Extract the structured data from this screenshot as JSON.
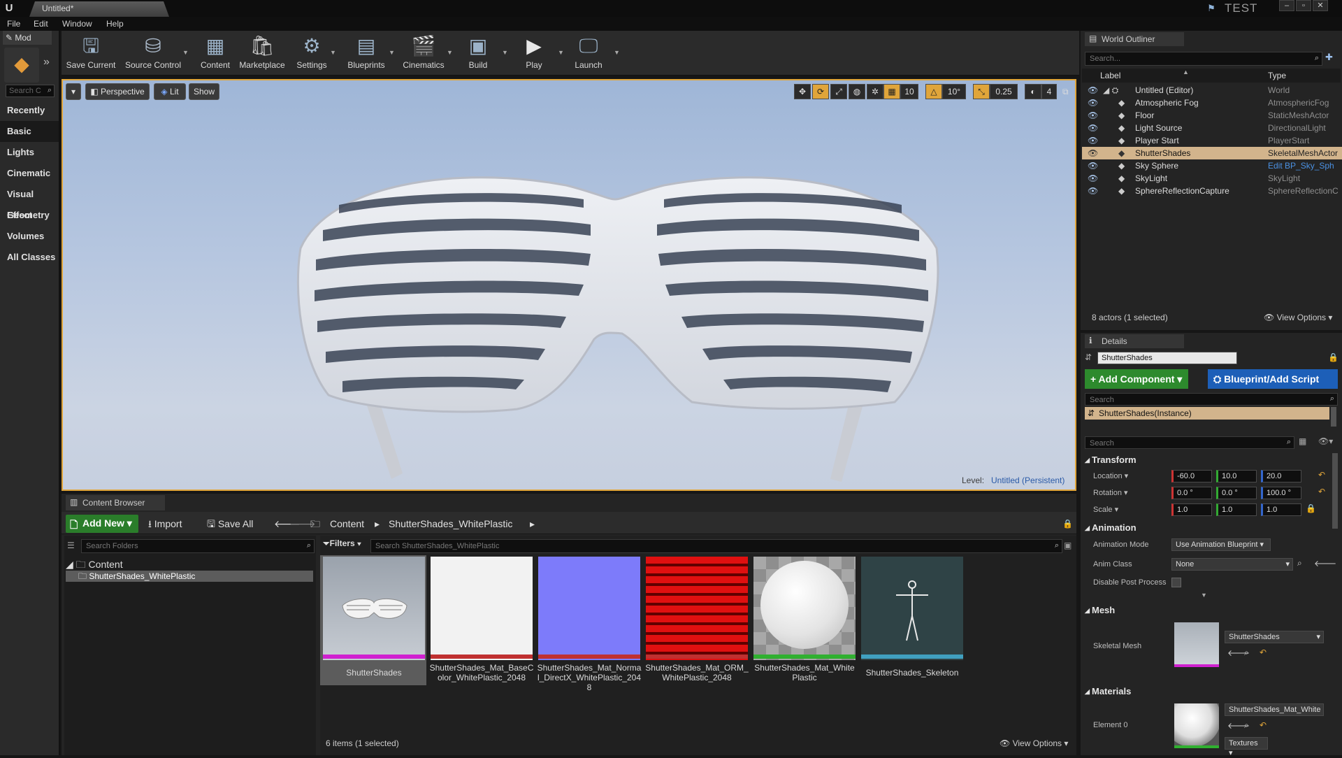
{
  "titlebar": {
    "doc_tab": "Untitled*",
    "project": "TEST"
  },
  "menu": [
    "File",
    "Edit",
    "Window",
    "Help"
  ],
  "modes": {
    "tab_label": "Mod",
    "search_placeholder": "Search C",
    "categories": [
      "Recently Pla",
      "Basic",
      "Lights",
      "Cinematic",
      "Visual Effect",
      "Geometry",
      "Volumes",
      "All Classes"
    ]
  },
  "toolbar": {
    "save": "Save Current",
    "source": "Source Control",
    "content": "Content",
    "marketplace": "Marketplace",
    "settings": "Settings",
    "blueprints": "Blueprints",
    "cinematics": "Cinematics",
    "build": "Build",
    "play": "Play",
    "launch": "Launch"
  },
  "viewport": {
    "perspective": "Perspective",
    "lit": "Lit",
    "show": "Show",
    "grid_snap": "10",
    "rot_snap": "10°",
    "scale_snap": "0.25",
    "cam_speed": "4",
    "level_label": "Level:",
    "level_value": "Untitled (Persistent)"
  },
  "content_browser": {
    "tab": "Content Browser",
    "add_new": "Add New",
    "import": "Import",
    "save_all": "Save All",
    "path": [
      "Content",
      "ShutterShades_WhitePlastic"
    ],
    "search_folders": "Search Folders",
    "tree_root": "Content",
    "tree_child": "ShutterShades_WhitePlastic",
    "filters": "Filters",
    "search_assets": "Search ShutterShades_WhitePlastic",
    "status": "6 items (1 selected)",
    "view_options": "View Options",
    "assets": [
      {
        "name": "ShutterShades",
        "color": "#d020d0"
      },
      {
        "name": "ShutterShades_Mat_BaseColor_WhitePlastic_2048",
        "color": "#c03030"
      },
      {
        "name": "ShutterShades_Mat_Normal_DirectX_WhitePlastic_2048",
        "color": "#c03030"
      },
      {
        "name": "ShutterShades_Mat_ORM_WhitePlastic_2048",
        "color": "#c03030"
      },
      {
        "name": "ShutterShades_Mat_WhitePlastic",
        "color": "#30b030"
      },
      {
        "name": "ShutterShades_Skeleton",
        "color": "#40a0c0"
      }
    ]
  },
  "world_outliner": {
    "tab": "World Outliner",
    "search_placeholder": "Search...",
    "col_label": "Label",
    "col_type": "Type",
    "rows": [
      {
        "label": "Untitled (Editor)",
        "type": "World"
      },
      {
        "label": "Atmospheric Fog",
        "type": "AtmosphericFog"
      },
      {
        "label": "Floor",
        "type": "StaticMeshActor"
      },
      {
        "label": "Light Source",
        "type": "DirectionalLight"
      },
      {
        "label": "Player Start",
        "type": "PlayerStart"
      },
      {
        "label": "ShutterShades",
        "type": "SkeletalMeshActor"
      },
      {
        "label": "Sky Sphere",
        "type": "Edit BP_Sky_Sph"
      },
      {
        "label": "SkyLight",
        "type": "SkyLight"
      },
      {
        "label": "SphereReflectionCapture",
        "type": "SphereReflectionC"
      }
    ],
    "status": "8 actors (1 selected)",
    "view_options": "View Options"
  },
  "details": {
    "tab": "Details",
    "actor_name": "ShutterShades",
    "add_component": "Add Component",
    "blueprint": "Blueprint/Add Script",
    "search": "Search",
    "instance": "ShutterShades(Instance)",
    "search2": "Search",
    "transform": "Transform",
    "location_label": "Location",
    "location": [
      "-60.0",
      "10.0",
      "20.0"
    ],
    "rotation_label": "Rotation",
    "rotation": [
      "0.0 °",
      "0.0 °",
      "100.0 °"
    ],
    "scale_label": "Scale",
    "scale": [
      "1.0",
      "1.0",
      "1.0"
    ],
    "animation": "Animation",
    "anim_mode_label": "Animation Mode",
    "anim_mode": "Use Animation Blueprint",
    "anim_class_label": "Anim Class",
    "anim_class": "None",
    "disable_pp_label": "Disable Post Process",
    "mesh": "Mesh",
    "skel_mesh_label": "Skeletal Mesh",
    "skel_mesh": "ShutterShades",
    "materials": "Materials",
    "element0_label": "Element 0",
    "element0": "ShutterShades_Mat_White",
    "textures": "Textures"
  }
}
